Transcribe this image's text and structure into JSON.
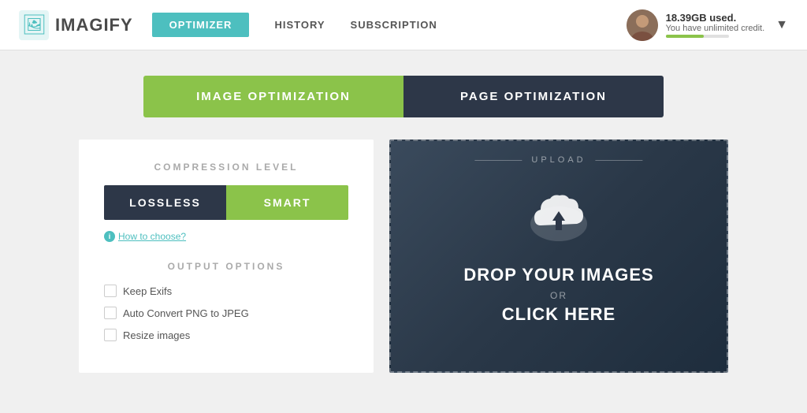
{
  "header": {
    "logo_text": "IMAGIFY",
    "nav": {
      "optimizer_label": "OPTIMIZER",
      "history_label": "HISTORY",
      "subscription_label": "SUBSCRIPTION"
    },
    "usage": {
      "gb_used": "18.39GB used.",
      "credit_text": "You have unlimited credit.",
      "bar_fill_pct": 60
    }
  },
  "tabs": {
    "image_optimization_label": "IMAGE OPTIMIZATION",
    "page_optimization_label": "PAGE OPTIMIZATION"
  },
  "left_panel": {
    "compression_label": "COMPRESSION LEVEL",
    "lossless_label": "LOSSLESS",
    "smart_label": "SMART",
    "how_to_choose_label": "How to choose?",
    "output_options_label": "OUTPUT OPTIONS",
    "checkboxes": [
      {
        "label": "Keep Exifs"
      },
      {
        "label": "Auto Convert PNG to JPEG"
      },
      {
        "label": "Resize images"
      }
    ]
  },
  "right_panel": {
    "upload_label": "UPLOAD",
    "drop_text_line1": "DROP YOUR IMAGES",
    "or_text": "OR",
    "click_text": "CLICK HERE"
  },
  "colors": {
    "green": "#8bc34a",
    "teal": "#4dbfbf",
    "dark": "#2d3748"
  }
}
